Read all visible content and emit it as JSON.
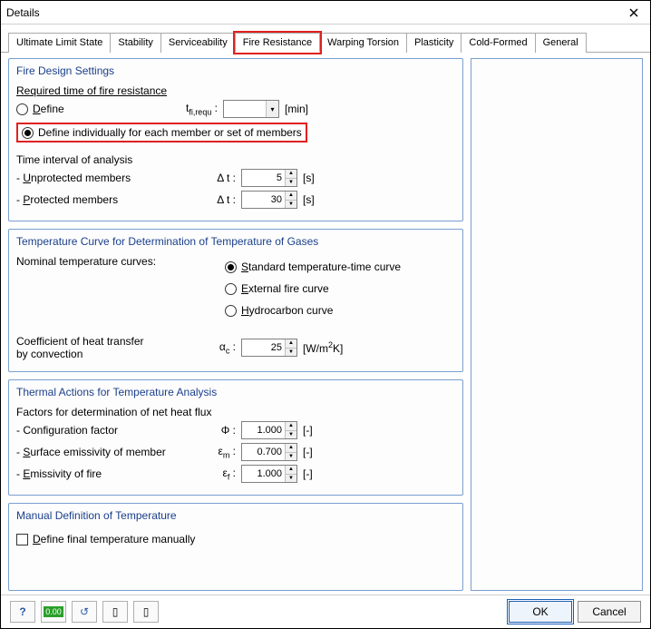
{
  "window": {
    "title": "Details"
  },
  "tabs": [
    {
      "label": "Ultimate Limit State"
    },
    {
      "label": "Stability"
    },
    {
      "label": "Serviceability"
    },
    {
      "label": "Fire Resistance"
    },
    {
      "label": "Warping Torsion"
    },
    {
      "label": "Plasticity"
    },
    {
      "label": "Cold-Formed"
    },
    {
      "label": "General"
    }
  ],
  "groups": {
    "fire_settings": {
      "title": "Fire Design Settings",
      "req_label": "Required time of fire resistance",
      "define_opt": "efine",
      "define_prefix": "D",
      "tfirequ_sym": "t fi,requ :",
      "tfirequ_unit": "[min]",
      "define_indiv": "Define individually for each member or set of members",
      "time_interval": "Time interval of analysis",
      "unprot_prefix": "- ",
      "unprot_u": "U",
      "unprot_rest": "nprotected members",
      "prot_prefix": "- ",
      "prot_p": "P",
      "prot_rest": "rotected members",
      "dt_sym": "Δ t :",
      "unprot_val": "5",
      "prot_val": "30",
      "s_unit": "[s]"
    },
    "temp_curve": {
      "title": "Temperature Curve for Determination of Temperature of Gases",
      "nominal": "Nominal temperature curves:",
      "std_s": "S",
      "std_rest": "tandard temperature-time curve",
      "ext_e": "E",
      "ext_rest": "xternal fire curve",
      "hyd_h": "H",
      "hyd_rest": "ydrocarbon curve",
      "coef_line1": "Coefficient of heat transfer",
      "coef_line2": "by convection",
      "alpha_sym": "αc :",
      "alpha_val": "25",
      "alpha_unit": "[W/m²K]"
    },
    "thermal": {
      "title": "Thermal Actions for Temperature Analysis",
      "factors": "Factors for determination of net heat flux",
      "conf_label": "- Configuration factor",
      "conf_sym": "Φ :",
      "conf_val": "1.000",
      "surf_prefix": "- ",
      "surf_s": "S",
      "surf_rest": "urface emissivity of member",
      "em_sym": "εm :",
      "em_val": "0.700",
      "fire_prefix": "- ",
      "fire_e": "E",
      "fire_rest": "missivity of fire",
      "ef_sym": "εf :",
      "ef_val": "1.000",
      "dash_unit": "[-]"
    },
    "manual": {
      "title": "Manual Definition of Temperature",
      "def_prefix": "",
      "def_d": "D",
      "def_rest": "efine final temperature manually"
    }
  },
  "footer": {
    "ok": "OK",
    "cancel": "Cancel"
  }
}
